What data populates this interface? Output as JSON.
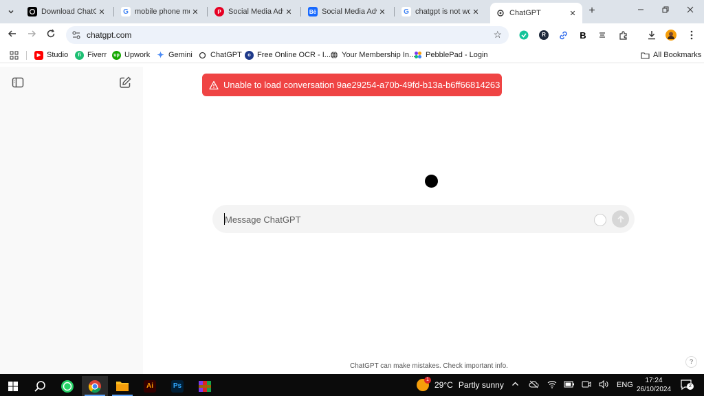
{
  "browser": {
    "tabs": [
      {
        "title": "Download ChatGPT",
        "favicon": "openai-icon",
        "color": "#000000"
      },
      {
        "title": "mobile phone mockup",
        "favicon": "google-icon",
        "color": "#4285f4"
      },
      {
        "title": "Social Media Advertising",
        "favicon": "pinterest-icon",
        "color": "#e60023"
      },
      {
        "title": "Social Media Advertising",
        "favicon": "behance-icon",
        "color": "#1769ff"
      },
      {
        "title": "chatgpt is not working",
        "favicon": "google-icon",
        "color": "#4285f4"
      },
      {
        "title": "ChatGPT",
        "favicon": "openai-icon",
        "color": "#000000",
        "active": true
      }
    ],
    "favicon_letters": {
      "behance": "Bē"
    },
    "new_tab": "+",
    "url": "chatgpt.com",
    "bookmarks": [
      {
        "label": "Studio",
        "icon": "youtube-icon",
        "color": "#ff0000"
      },
      {
        "label": "Fiverr",
        "icon": "fiverr-icon",
        "color": "#1dbf73"
      },
      {
        "label": "Upwork",
        "icon": "upwork-icon",
        "color": "#14a800"
      },
      {
        "label": "Gemini",
        "icon": "gemini-icon",
        "color": "#4b8bf5"
      },
      {
        "label": "ChatGPT",
        "icon": "openai-icon",
        "color": "#333333"
      },
      {
        "label": "Free Online OCR - I...",
        "icon": "ocr-icon",
        "color": "#1e3a8a"
      },
      {
        "label": "Your Membership In...",
        "icon": "globe-icon",
        "color": "#333333"
      },
      {
        "label": "PebblePad - Login",
        "icon": "pebblepad-icon",
        "color": "#7c3aed"
      }
    ],
    "all_bookmarks": "All Bookmarks",
    "extension_letters": {
      "r": "R",
      "b": "B"
    }
  },
  "page": {
    "error": "Unable to load conversation 9ae29254-a70b-49fd-b13a-b6ff66814263",
    "composer_placeholder": "Message ChatGPT",
    "disclaimer": "ChatGPT can make mistakes. Check important info.",
    "help": "?",
    "error_color": "#ef4444"
  },
  "taskbar": {
    "app_letters": {
      "illustrator": "Ai",
      "photoshop": "Ps"
    },
    "weather_badge": "1",
    "temperature": "29°C",
    "condition": "Partly sunny",
    "language": "ENG",
    "time": "17:24",
    "date": "26/10/2024",
    "notification_count": "2"
  }
}
